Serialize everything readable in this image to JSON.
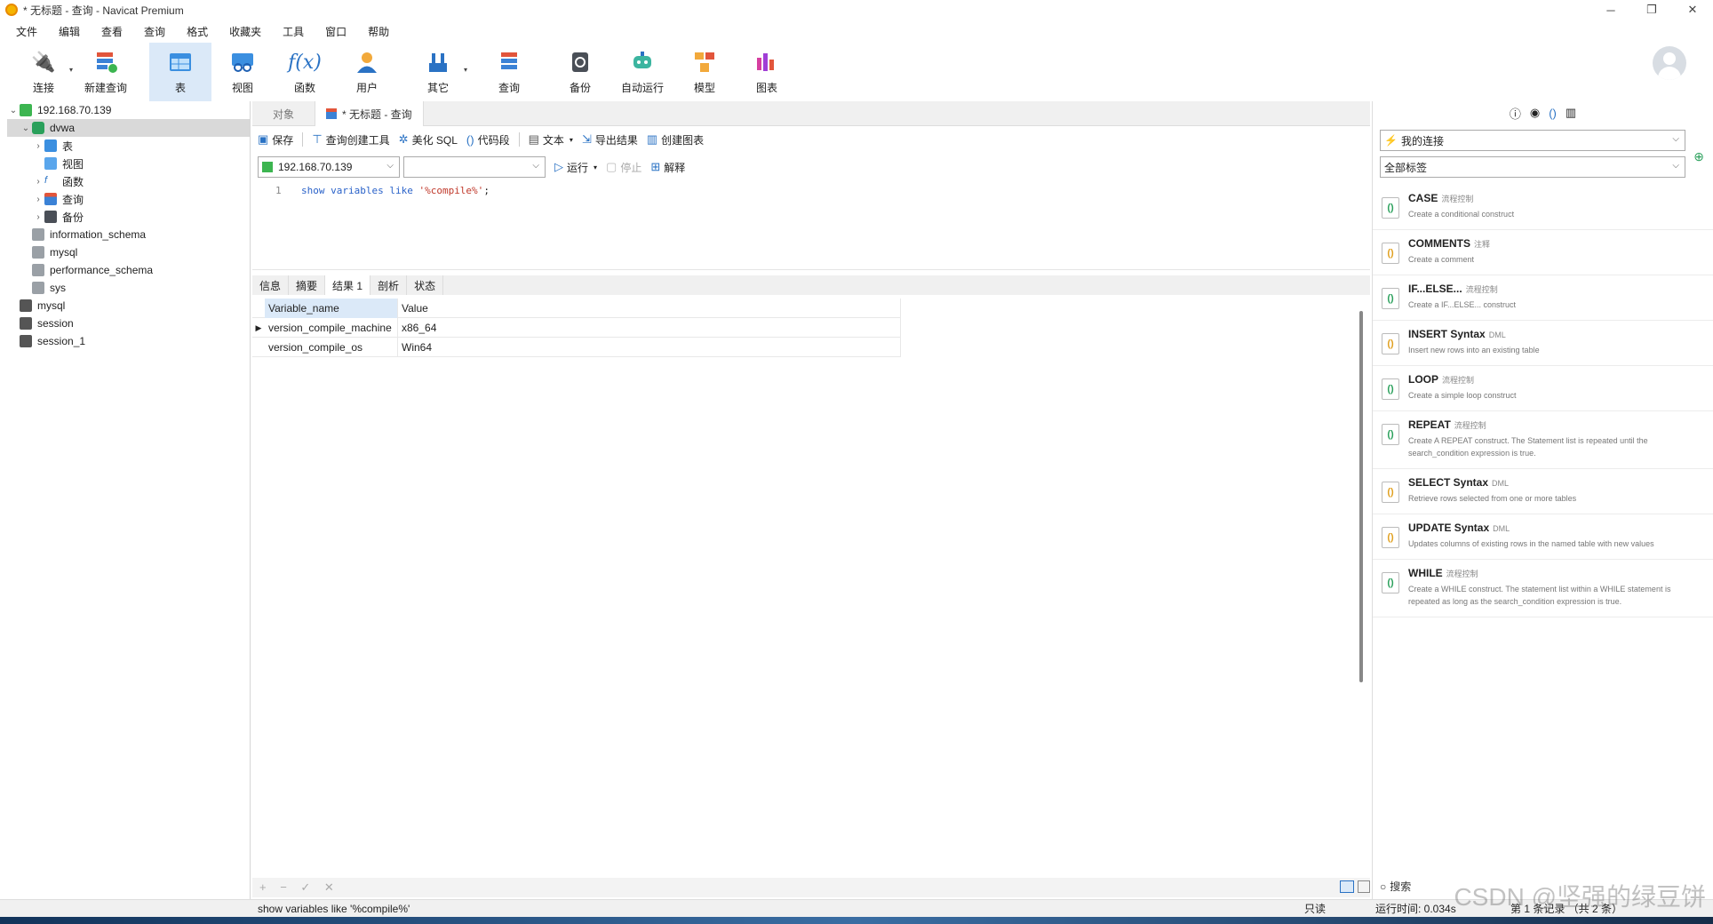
{
  "window": {
    "title": "* 无标题 - 查询 - Navicat Premium"
  },
  "menu": [
    "文件",
    "编辑",
    "查看",
    "查询",
    "格式",
    "收藏夹",
    "工具",
    "窗口",
    "帮助"
  ],
  "toolbar": [
    {
      "label": "连接",
      "icon": "connection-icon"
    },
    {
      "label": "新建查询",
      "icon": "new-query-icon"
    },
    {
      "label": "表",
      "icon": "table-icon"
    },
    {
      "label": "视图",
      "icon": "view-icon"
    },
    {
      "label": "函数",
      "icon": "function-icon"
    },
    {
      "label": "用户",
      "icon": "user-icon"
    },
    {
      "label": "其它",
      "icon": "other-icon"
    },
    {
      "label": "查询",
      "icon": "query-icon"
    },
    {
      "label": "备份",
      "icon": "backup-icon"
    },
    {
      "label": "自动运行",
      "icon": "automation-icon"
    },
    {
      "label": "模型",
      "icon": "model-icon"
    },
    {
      "label": "图表",
      "icon": "chart-icon"
    }
  ],
  "tree": [
    {
      "label": "192.168.70.139",
      "level": 0,
      "expanded": true
    },
    {
      "label": "dvwa",
      "level": 1,
      "expanded": true
    },
    {
      "label": "表",
      "level": 2
    },
    {
      "label": "视图",
      "level": 2
    },
    {
      "label": "函数",
      "level": 2
    },
    {
      "label": "查询",
      "level": 2
    },
    {
      "label": "备份",
      "level": 2
    },
    {
      "label": "information_schema",
      "level": 1
    },
    {
      "label": "mysql",
      "level": 1
    },
    {
      "label": "performance_schema",
      "level": 1
    },
    {
      "label": "sys",
      "level": 1
    },
    {
      "label": "mysql",
      "level": 0
    },
    {
      "label": "session",
      "level": 0
    },
    {
      "label": "session_1",
      "level": 0
    }
  ],
  "tabs": {
    "objects": "对象",
    "query": "* 无标题 - 查询"
  },
  "query_toolbar": {
    "save": "保存",
    "builder": "查询创建工具",
    "beautify": "美化 SQL",
    "snippet": "代码段",
    "text": "文本",
    "export": "导出结果",
    "create_chart": "创建图表",
    "run": "运行",
    "stop": "停止",
    "explain": "解释"
  },
  "connection_select": "192.168.70.139",
  "database_select": "",
  "editor": {
    "line": "1",
    "code_kw": "show variables like ",
    "code_str": "'%compile%'",
    "code_end": ";"
  },
  "result_tabs": [
    "信息",
    "摘要",
    "结果 1",
    "剖析",
    "状态"
  ],
  "result": {
    "columns": [
      "Variable_name",
      "Value"
    ],
    "rows": [
      [
        "version_compile_machine",
        "x86_64"
      ],
      [
        "version_compile_os",
        "Win64"
      ]
    ]
  },
  "grid_footer": "+ − ✓ ✕",
  "right_panel": {
    "connection": "我的连接",
    "labels": "全部标签",
    "snippets": [
      {
        "title": "CASE",
        "tag": "流程控制",
        "desc": "Create a conditional construct"
      },
      {
        "title": "COMMENTS",
        "tag": "注释",
        "desc": "Create a comment"
      },
      {
        "title": "IF...ELSE...",
        "tag": "流程控制",
        "desc": "Create a IF...ELSE... construct"
      },
      {
        "title": "INSERT Syntax",
        "tag": "DML",
        "desc": "Insert new rows into an existing table"
      },
      {
        "title": "LOOP",
        "tag": "流程控制",
        "desc": "Create a simple loop construct"
      },
      {
        "title": "REPEAT",
        "tag": "流程控制",
        "desc": "Create A REPEAT construct. The Statement list is repeated until the search_condition expression is true."
      },
      {
        "title": "SELECT Syntax",
        "tag": "DML",
        "desc": "Retrieve rows selected from one or more tables"
      },
      {
        "title": "UPDATE Syntax",
        "tag": "DML",
        "desc": "Updates columns of existing rows in the named table with new values"
      },
      {
        "title": "WHILE",
        "tag": "流程控制",
        "desc": "Create a WHILE construct. The statement list within a WHILE statement is repeated as long as the search_condition expression is true."
      }
    ],
    "search": "搜索"
  },
  "status": {
    "sql": "show variables like '%compile%'",
    "readonly": "只读",
    "runtime": "运行时间: 0.034s",
    "records": "第 1 条记录 （共 2 条）"
  },
  "watermark": "CSDN @坚强的绿豆饼"
}
